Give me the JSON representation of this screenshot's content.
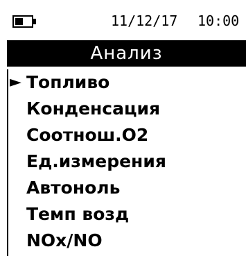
{
  "status": {
    "battery": {
      "icon": "battery-icon",
      "charge_fraction": 0.5
    },
    "date": "11/12/17",
    "time": "10:00"
  },
  "header": {
    "title": "Анализ"
  },
  "menu": {
    "cursor": "►",
    "selected_index": 0,
    "items": [
      {
        "label": "Топливо"
      },
      {
        "label": "Конденсация"
      },
      {
        "label": "Соотнош.O2"
      },
      {
        "label": "Ед.измерения"
      },
      {
        "label": "Автоноль"
      },
      {
        "label": "Темп возд"
      },
      {
        "label": "NOx/NO"
      }
    ]
  }
}
